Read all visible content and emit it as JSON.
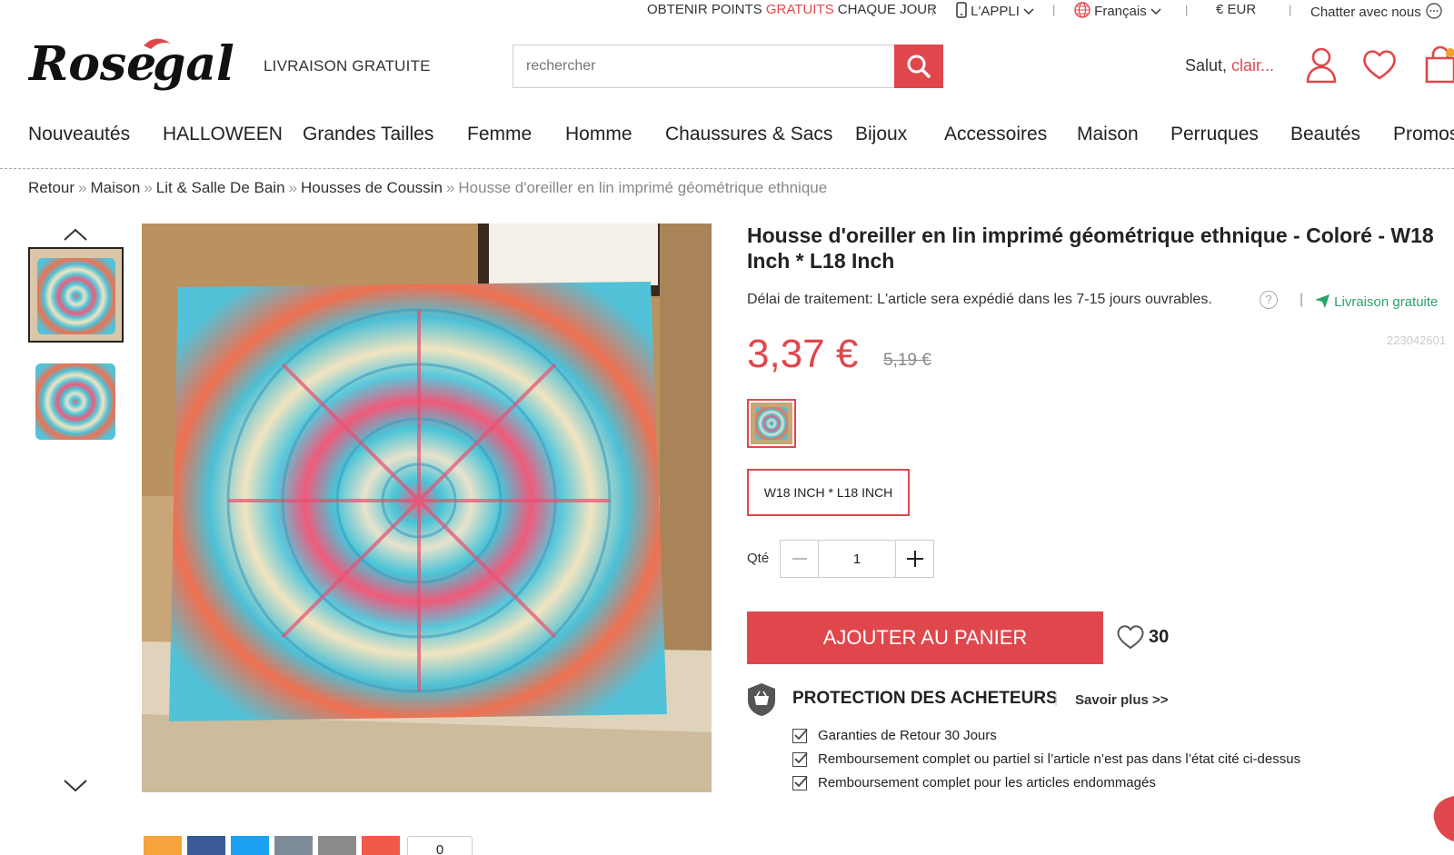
{
  "topbar": {
    "points_pre": "OBTENIR POINTS ",
    "points_red": "GRATUITS",
    "points_post": " CHAQUE JOUR",
    "app": "L'APPLI",
    "language": "Français",
    "currency": "€ EUR",
    "chat": "Chatter avec nous"
  },
  "header": {
    "logo_text": "Rosegal",
    "free_shipping": "LIVRAISON GRATUITE",
    "search_placeholder": "rechercher",
    "greeting": "Salut,",
    "username": "clair..."
  },
  "nav": [
    "Nouveautés",
    "HALLOWEEN",
    "Grandes Tailles",
    "Femme",
    "Homme",
    "Chaussures & Sacs",
    "Bijoux",
    "Accessoires",
    "Maison",
    "Perruques",
    "Beautés",
    "Promos"
  ],
  "breadcrumb": {
    "items": [
      "Retour",
      "Maison",
      "Lit & Salle De Bain",
      "Housses de Coussin"
    ],
    "current": "Housse d'oreiller en lin imprimé géométrique ethnique"
  },
  "product": {
    "title": "Housse d'oreiller en lin imprimé géométrique ethnique - Coloré - W18 Inch * L18 Inch",
    "lead_time": "Délai de traitement: L'article sera expédié dans les 7-15 jours ouvrables.",
    "help": "?",
    "free_shipping": "Livraison gratuite",
    "sku": "223042601",
    "price": "3,37 €",
    "old_price": "5,19 €",
    "size": "W18 INCH * L18 INCH",
    "qty_label": "Qté",
    "qty_value": "1",
    "add_to_cart": "AJOUTER AU PANIER",
    "wishlist_count": "30"
  },
  "protection": {
    "title": "PROTECTION DES ACHETEURS",
    "link": "Savoir plus >>",
    "items": [
      "Garanties de Retour 30 Jours",
      "Remboursement complet ou partiel si l’article n’est pas dans l’état cité ci-dessus",
      "Remboursement complet pour les articles endommagés"
    ]
  },
  "share": {
    "count": "0"
  },
  "colors": {
    "accent": "#e0474c",
    "green": "#2aa36a"
  }
}
